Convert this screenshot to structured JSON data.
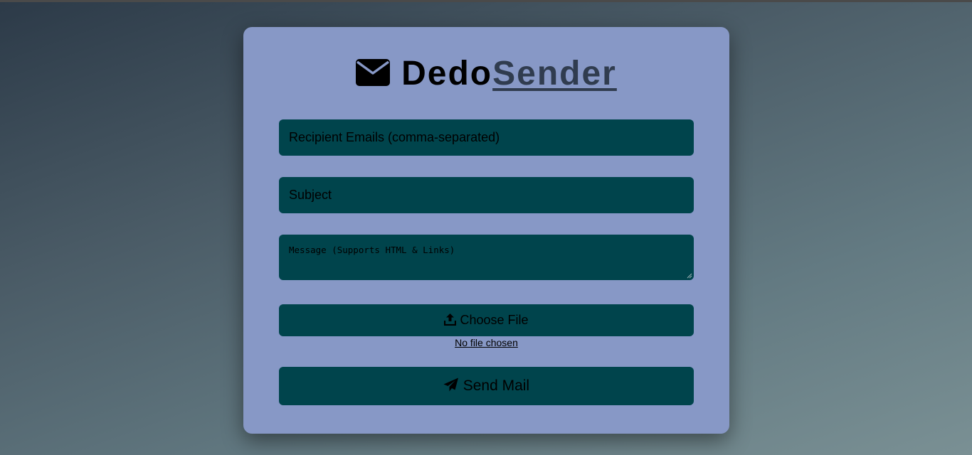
{
  "header": {
    "icon": "envelope-icon",
    "title_part1": "Dedo",
    "title_part2": "Sender"
  },
  "form": {
    "recipients_placeholder": "Recipient Emails (comma-separated)",
    "subject_placeholder": "Subject",
    "message_placeholder": "Message (Supports HTML & Links)",
    "file_button_label": "Choose File",
    "file_button_icon": "upload-icon",
    "file_status": "No file chosen",
    "send_button_label": "Send Mail",
    "send_button_icon": "paper-plane-icon"
  },
  "colors": {
    "card_background": "#8798c6",
    "field_background": "#00444c",
    "title_accent": "#303c4f"
  }
}
